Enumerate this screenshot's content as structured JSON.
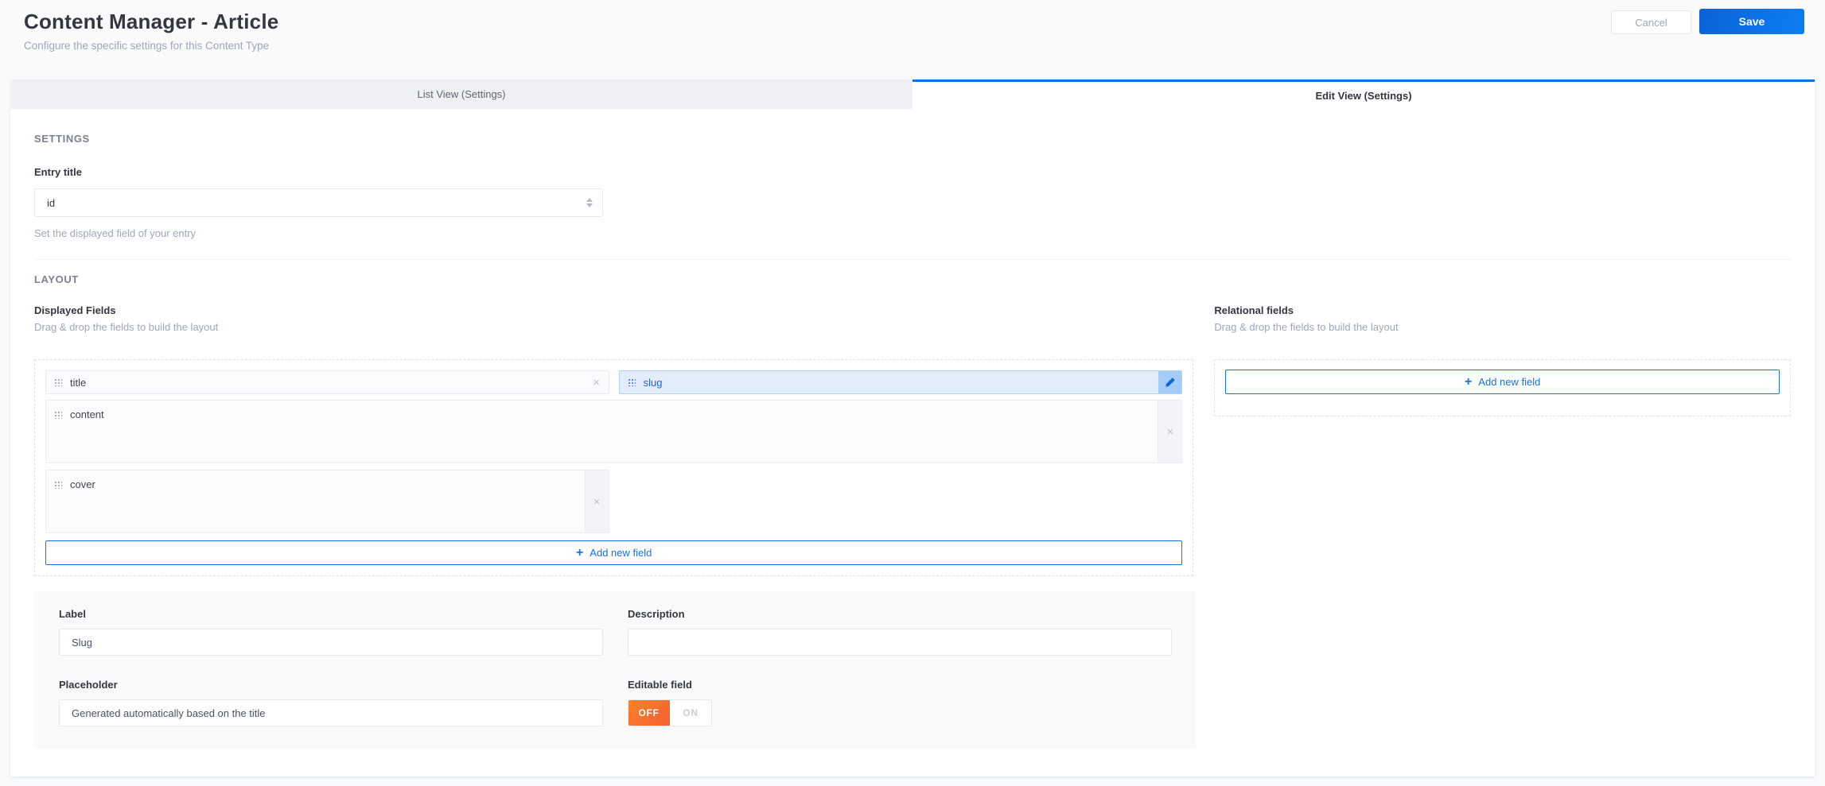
{
  "header": {
    "title": "Content Manager - Article",
    "subtitle": "Configure the specific settings for this Content Type",
    "cancel_label": "Cancel",
    "save_label": "Save"
  },
  "tabs": [
    {
      "label": "List View (Settings)",
      "active": false
    },
    {
      "label": "Edit View (Settings)",
      "active": true
    }
  ],
  "settings_section": {
    "heading": "SETTINGS",
    "entry_title": {
      "label": "Entry title",
      "selected_value": "id",
      "help": "Set the displayed field of your entry"
    }
  },
  "layout_section": {
    "heading": "LAYOUT",
    "displayed_fields": {
      "title": "Displayed Fields",
      "subtitle": "Drag & drop the fields to build the layout",
      "fields": [
        {
          "name": "title",
          "size": "small",
          "selected": false
        },
        {
          "name": "slug",
          "size": "small",
          "selected": true
        },
        {
          "name": "content",
          "size": "large-full"
        },
        {
          "name": "cover",
          "size": "large-half"
        }
      ],
      "add_button_label": "Add new field"
    },
    "relational_fields": {
      "title": "Relational fields",
      "subtitle": "Drag & drop the fields to build the layout",
      "add_button_label": "Add new field"
    }
  },
  "field_form": {
    "label": {
      "label": "Label",
      "value": "Slug"
    },
    "description": {
      "label": "Description",
      "value": ""
    },
    "placeholder": {
      "label": "Placeholder",
      "value": "Generated automatically based on the title"
    },
    "editable": {
      "label": "Editable field",
      "off_label": "OFF",
      "on_label": "ON",
      "value": "OFF"
    }
  },
  "icons": {
    "close": "×",
    "plus": "+"
  },
  "colors": {
    "accent_blue": "#1472e6",
    "tab_active_border": "#0e70ec",
    "save_gradient_start": "#0a62d8",
    "save_gradient_end": "#0d7ef3",
    "toggle_off_orange": "#f8702d",
    "selected_pill_bg": "#e2ecfa",
    "selected_pill_border": "#aed4fa",
    "panel_bg": "#fafafb"
  }
}
